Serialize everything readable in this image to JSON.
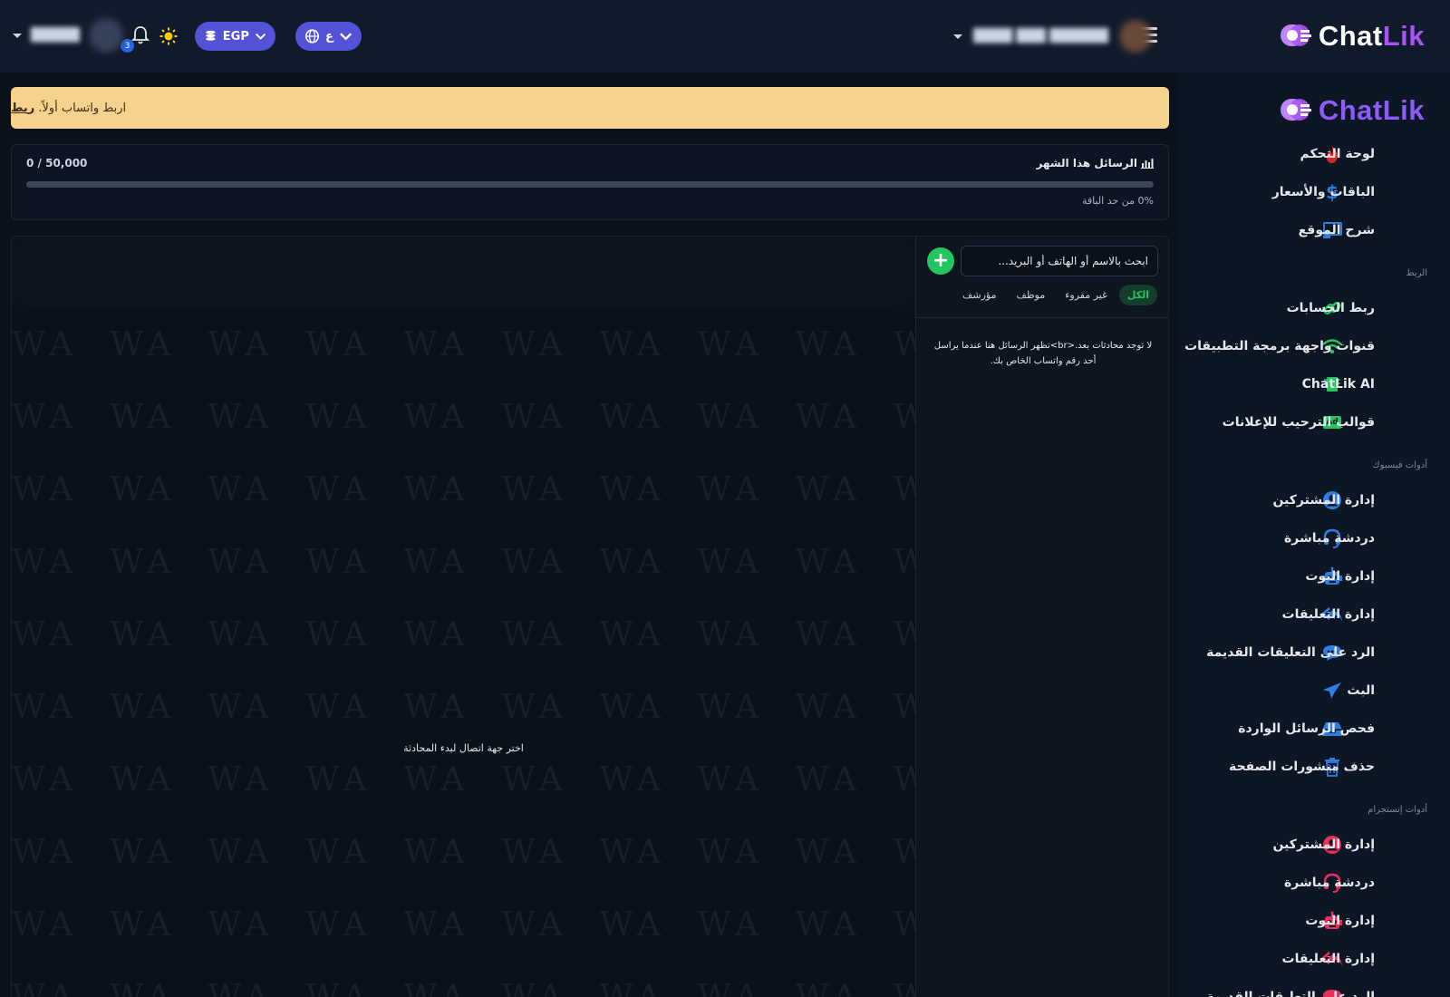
{
  "brand": {
    "name_part1": "Chat",
    "name_part2": "Lik",
    "accent": "#a855f7"
  },
  "header": {
    "lang_label": "ع",
    "currency_label": "EGP",
    "notif_count": "3"
  },
  "alert": {
    "text": "اربط واتساب أولاً.",
    "link": "ربط"
  },
  "usage": {
    "title": "الرسائل هذا الشهر",
    "count": "0 / 50,000",
    "used": 0,
    "limit": 50000,
    "percent_text": "0% من حد الباقة"
  },
  "chat": {
    "search_placeholder": "ابحث بالاسم أو الهاتف أو البريد...",
    "tabs": [
      "الكل",
      "غير مقروء",
      "موظف",
      "مؤرشف"
    ],
    "empty_list": "لا توجد محادثات بعد.<br>تظهر الرسائل هنا عندما يراسل أحد رقم واتساب الخاص بك.",
    "empty_chat": "اختر جهة اتصال لبدء المحادثة",
    "watermark": "WA"
  },
  "sidebar": {
    "items": [
      {
        "label": "لوحة التحكم",
        "icon": "fire-icon"
      },
      {
        "label": "الباقات والأسعار",
        "icon": "dollar-icon"
      },
      {
        "label": "شرح الموقع",
        "icon": "presentation-icon"
      }
    ],
    "section_link": "الربط",
    "link_items": [
      {
        "label": "ربط الحسابات",
        "icon": "link-icon"
      },
      {
        "label": "قنوات واجهة برمجة التطبيقات",
        "icon": "wifi-icon"
      },
      {
        "label": "ChatLik AI",
        "icon": "chip-icon"
      },
      {
        "label": "قوالب الترحيب للإعلانات",
        "icon": "ad-icon"
      }
    ],
    "section_fb": "أدوات فيسبوك",
    "fb_items": [
      {
        "label": "إدارة المشتركين",
        "icon": "user-circle-icon"
      },
      {
        "label": "دردشة مباشرة",
        "icon": "headset-icon"
      },
      {
        "label": "إدارة البوت",
        "icon": "robot-icon"
      },
      {
        "label": "إدارة التعليقات",
        "icon": "reply-all-icon"
      },
      {
        "label": "الرد على التعليقات القديمة",
        "icon": "comment-dots-icon"
      },
      {
        "label": "البث",
        "icon": "paper-plane-icon"
      },
      {
        "label": "فحص الرسائل الواردة",
        "icon": "inbox-icon"
      },
      {
        "label": "حذف منشورات الصفحة",
        "icon": "trash-icon"
      }
    ],
    "section_ig": "أدوات إنستجرام",
    "ig_items": [
      {
        "label": "إدارة المشتركين",
        "icon": "user-circle-icon"
      },
      {
        "label": "دردشة مباشرة",
        "icon": "headset-icon"
      },
      {
        "label": "إدارة البوت",
        "icon": "robot-icon"
      },
      {
        "label": "إدارة التعليقات",
        "icon": "reply-all-icon"
      },
      {
        "label": "الرد على التعليقات القديمة",
        "icon": "comment-dots-icon"
      }
    ]
  },
  "colors": {
    "fb_icon": "#2f7de1",
    "ig_icon": "#e8305a",
    "green": "#22c55e",
    "pill": "#5452d6"
  }
}
